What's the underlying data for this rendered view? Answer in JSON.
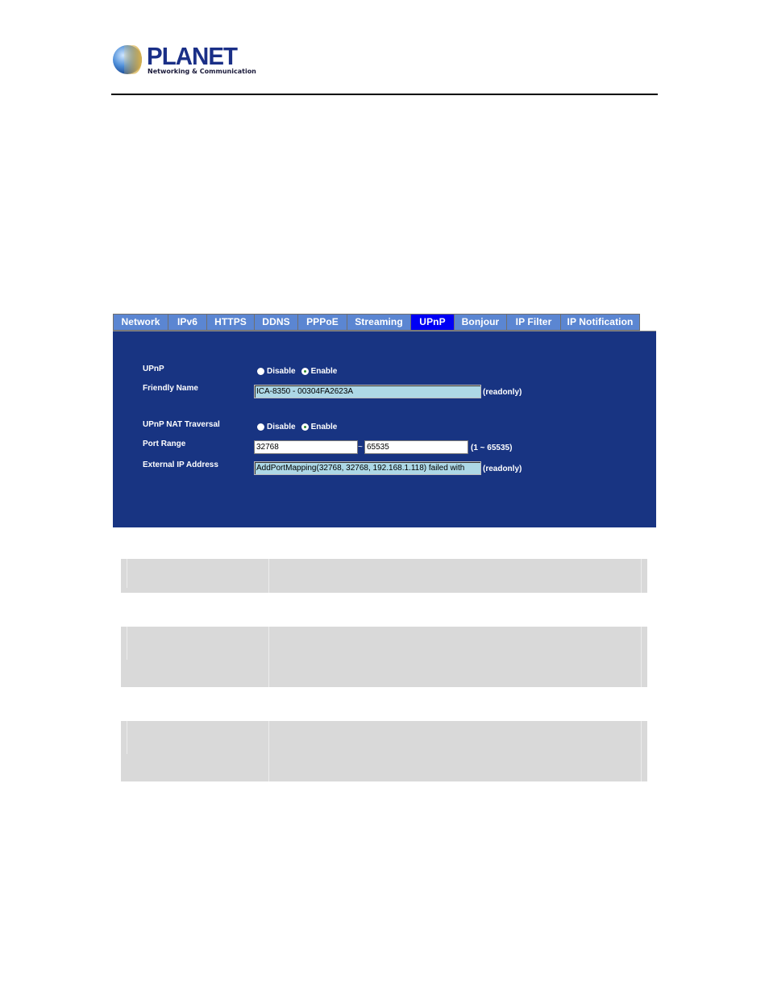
{
  "header": {
    "brand": "PLANET",
    "tagline": "Networking & Communication"
  },
  "tabs": [
    {
      "label": "Network",
      "active": false
    },
    {
      "label": "IPv6",
      "active": false
    },
    {
      "label": "HTTPS",
      "active": false
    },
    {
      "label": "DDNS",
      "active": false
    },
    {
      "label": "PPPoE",
      "active": false
    },
    {
      "label": "Streaming",
      "active": false
    },
    {
      "label": "UPnP",
      "active": true
    },
    {
      "label": "Bonjour",
      "active": false
    },
    {
      "label": "IP Filter",
      "active": false
    },
    {
      "label": "IP Notification",
      "active": false
    }
  ],
  "form": {
    "upnp": {
      "label": "UPnP",
      "options": [
        "Disable",
        "Enable"
      ],
      "selected": "Enable"
    },
    "friendly_name": {
      "label": "Friendly Name",
      "value": "ICA-8350 - 00304FA2623A",
      "note": "(readonly)"
    },
    "nat_traversal": {
      "label": "UPnP NAT Traversal",
      "options": [
        "Disable",
        "Enable"
      ],
      "selected": "Enable"
    },
    "port_range": {
      "label": "Port Range",
      "from": "32768",
      "separator": "~",
      "to": "65535",
      "note": "(1 ~ 65535)"
    },
    "external_ip": {
      "label": "External IP Address",
      "value": "AddPortMapping(32768, 32768, 192.168.1.118) failed with",
      "note": "(readonly)"
    }
  },
  "colors": {
    "panel_bg": "#183482",
    "tab_bg": "#5b86d2",
    "tab_active_bg": "#0000f5",
    "readonly_field_bg": "#add8e6",
    "table_bg": "#d9d9d9"
  }
}
